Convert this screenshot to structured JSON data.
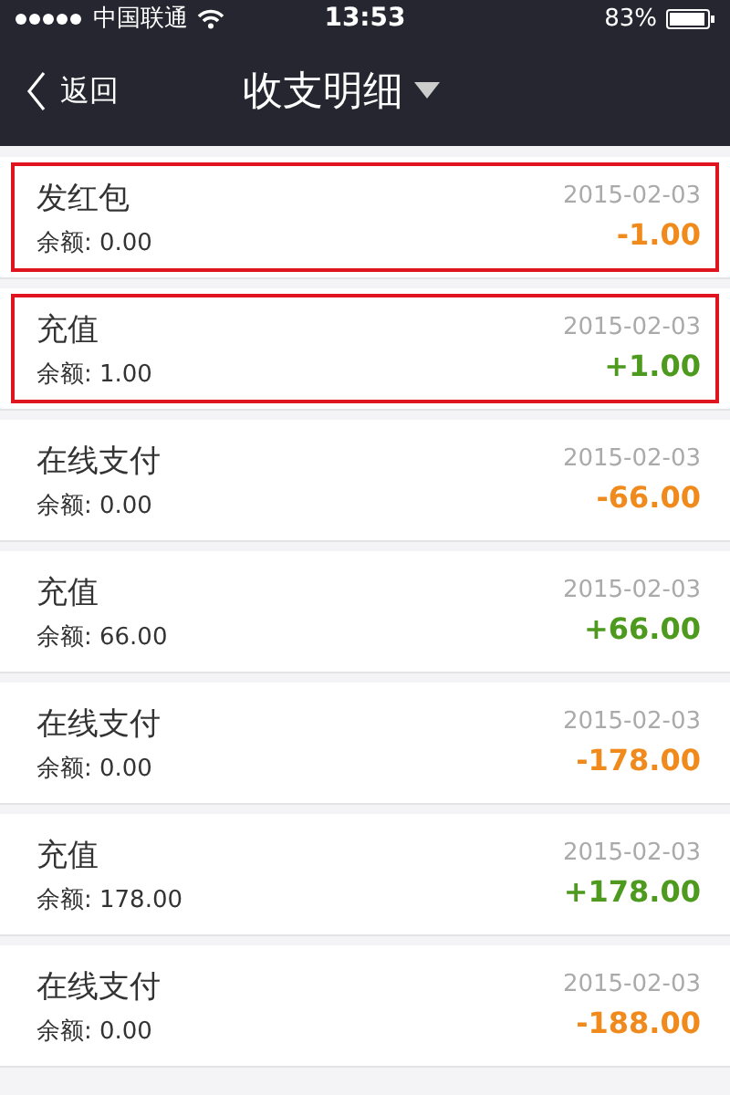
{
  "status_bar": {
    "carrier": "中国联通",
    "time": "13:53",
    "battery": "83%"
  },
  "nav": {
    "back": "返回",
    "title": "收支明细"
  },
  "records": [
    {
      "title": "发红包",
      "balance": "余额: 0.00",
      "date": "2015-02-03",
      "amount": "-1.00",
      "kind": "expense",
      "highlighted": true
    },
    {
      "title": "充值",
      "balance": "余额: 1.00",
      "date": "2015-02-03",
      "amount": "+1.00",
      "kind": "income",
      "highlighted": true
    },
    {
      "title": "在线支付",
      "balance": "余额: 0.00",
      "date": "2015-02-03",
      "amount": "-66.00",
      "kind": "expense",
      "highlighted": false
    },
    {
      "title": "充值",
      "balance": "余额: 66.00",
      "date": "2015-02-03",
      "amount": "+66.00",
      "kind": "income",
      "highlighted": false
    },
    {
      "title": "在线支付",
      "balance": "余额: 0.00",
      "date": "2015-02-03",
      "amount": "-178.00",
      "kind": "expense",
      "highlighted": false
    },
    {
      "title": "充值",
      "balance": "余额: 178.00",
      "date": "2015-02-03",
      "amount": "+178.00",
      "kind": "income",
      "highlighted": false
    },
    {
      "title": "在线支付",
      "balance": "余额: 0.00",
      "date": "2015-02-03",
      "amount": "-188.00",
      "kind": "expense",
      "highlighted": false
    }
  ]
}
